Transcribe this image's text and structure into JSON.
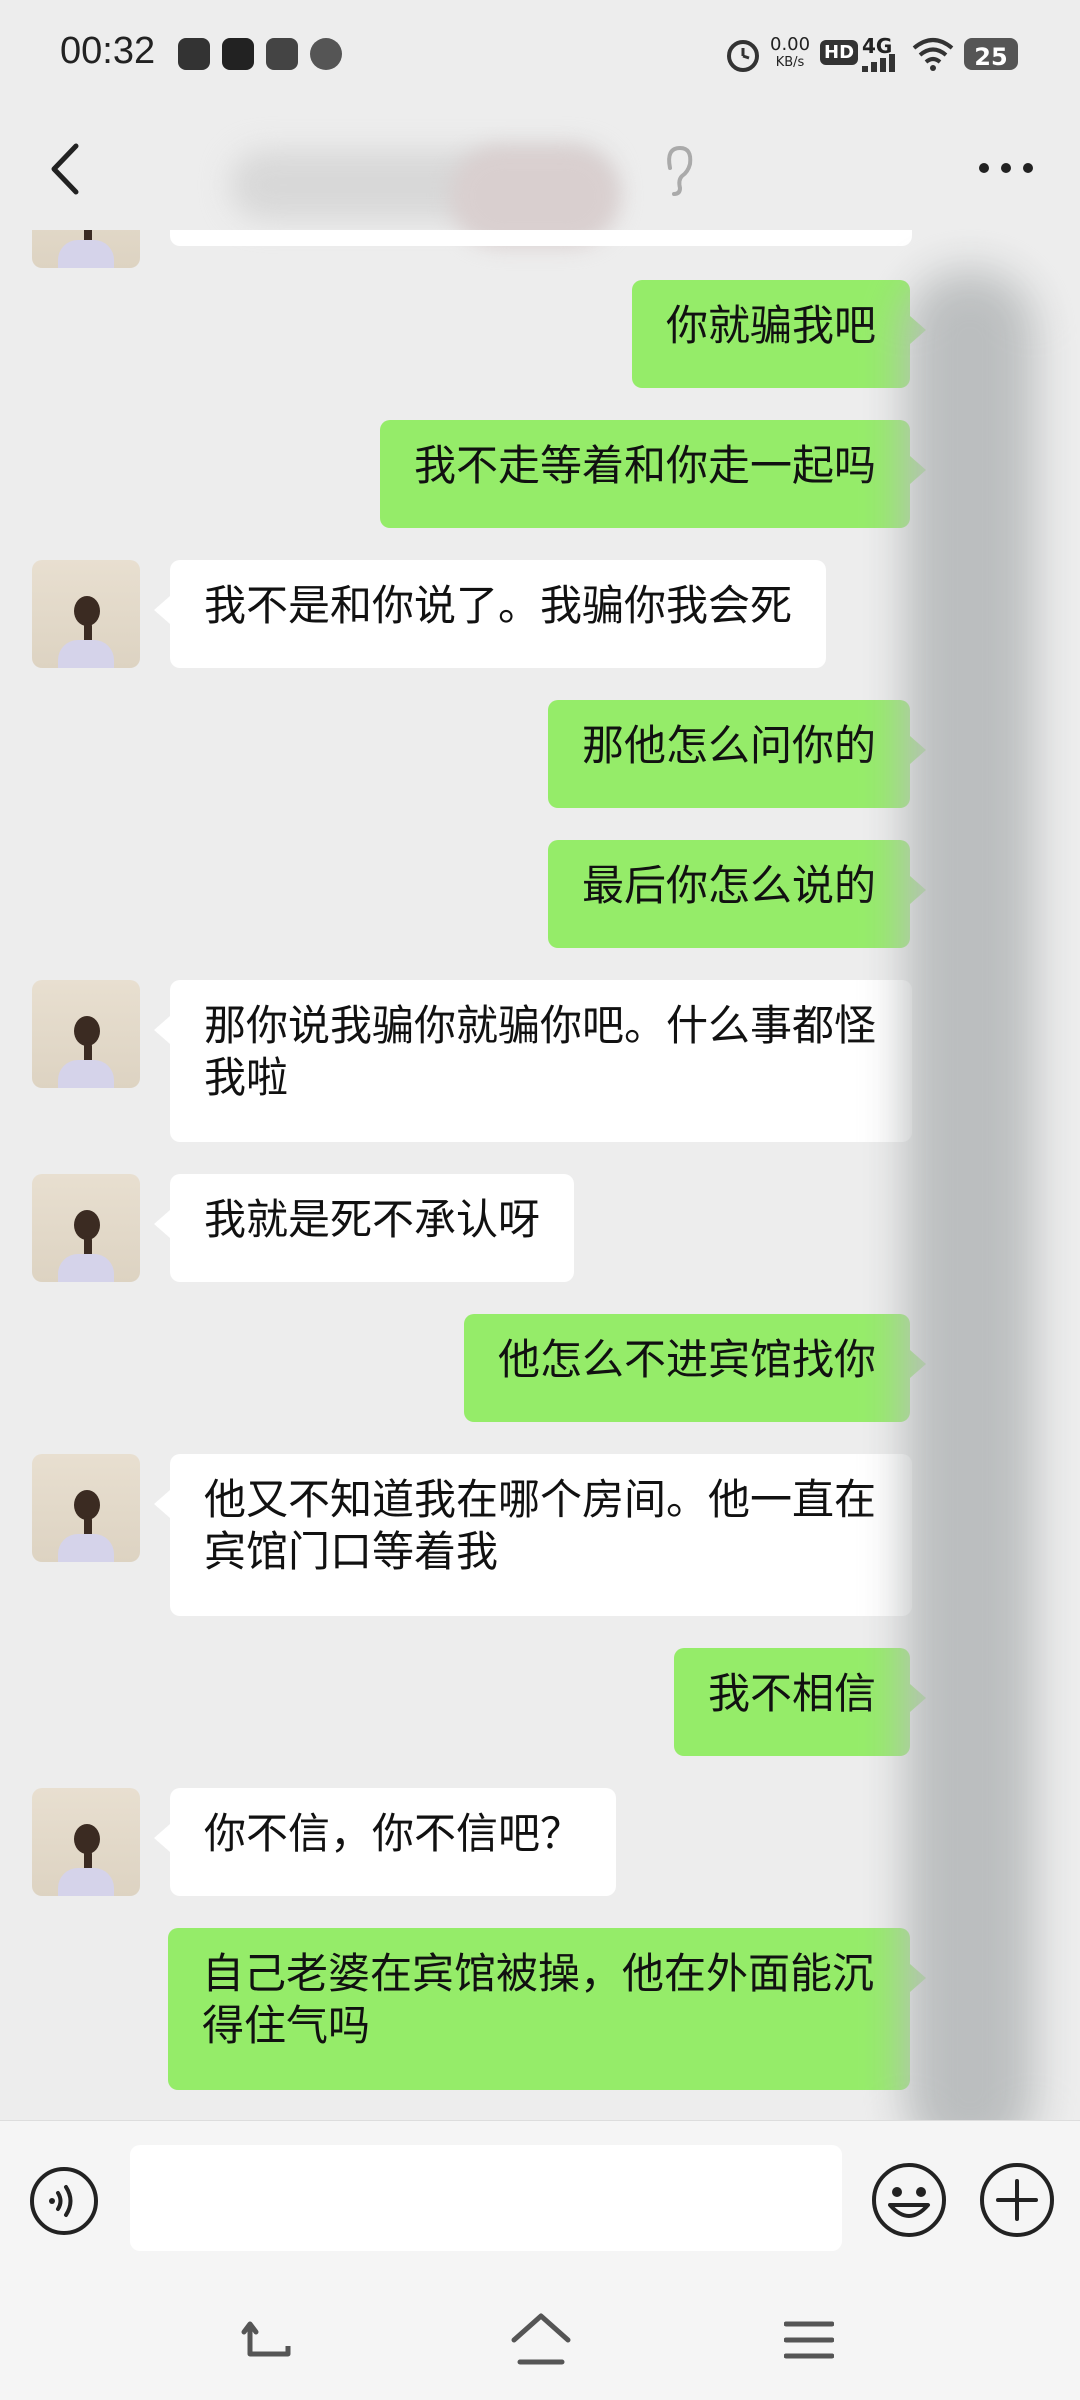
{
  "status_bar": {
    "time": "00:32",
    "net_speed": "0.00",
    "net_unit": "KB/s",
    "hd": "HD",
    "signal": "4G",
    "battery": "25",
    "app_icons": [
      "app-icon",
      "tiktok-icon",
      "telegram-icon",
      "compass-icon"
    ]
  },
  "header": {
    "title": ""
  },
  "messages": [
    {
      "side": "out",
      "text": "你就骗我吧"
    },
    {
      "side": "out",
      "text": "我不走等着和你走一起吗"
    },
    {
      "side": "in",
      "text": "我不是和你说了。我骗你我会死"
    },
    {
      "side": "out",
      "text": "那他怎么问你的"
    },
    {
      "side": "out",
      "text": "最后你怎么说的"
    },
    {
      "side": "in",
      "text": "那你说我骗你就骗你吧。什么事都怪我啦"
    },
    {
      "side": "in",
      "text": "我就是死不承认呀"
    },
    {
      "side": "out",
      "text": "他怎么不进宾馆找你"
    },
    {
      "side": "in",
      "text": "他又不知道我在哪个房间。他一直在宾馆门口等着我"
    },
    {
      "side": "out",
      "text": "我不相信"
    },
    {
      "side": "in",
      "text": "你不信，你不信吧？"
    },
    {
      "side": "out",
      "text": "自己老婆在宾馆被操，他在外面能沉得住气吗"
    }
  ],
  "colors": {
    "background": "#ededed",
    "outgoing_bubble": "#95ec69",
    "incoming_bubble": "#ffffff"
  },
  "input": {
    "value": ""
  }
}
